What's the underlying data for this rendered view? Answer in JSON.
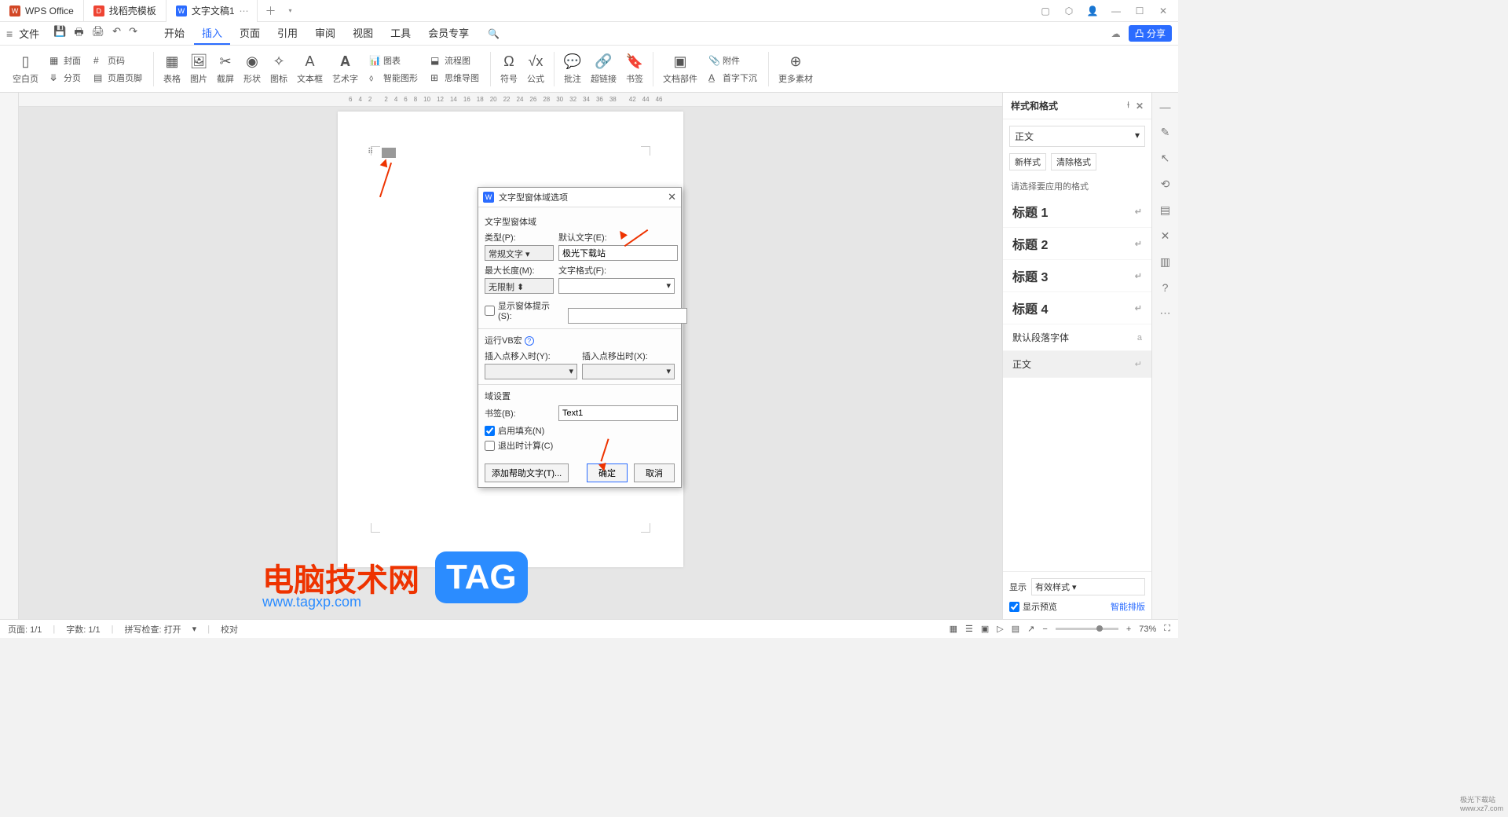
{
  "titlebar": {
    "tabs": [
      {
        "icon": "W",
        "label": "WPS Office"
      },
      {
        "icon": "D",
        "label": "找稻壳模板"
      },
      {
        "icon": "W",
        "label": "文字文稿1"
      }
    ]
  },
  "menubar": {
    "file": "文件",
    "tabs": [
      "开始",
      "插入",
      "页面",
      "引用",
      "审阅",
      "视图",
      "工具",
      "会员专享"
    ],
    "active_tab": "插入",
    "share": "分享"
  },
  "ribbon": {
    "blank_page": "空白页",
    "cover": "封面",
    "page_number": "页码",
    "page_break": "分页",
    "header_footer": "页眉页脚",
    "table": "表格",
    "picture": "图片",
    "screenshot": "截屏",
    "shape": "形状",
    "icon": "图标",
    "textbox": "文本框",
    "wordart": "艺术字",
    "chart": "图表",
    "flowchart": "流程图",
    "smartart": "智能图形",
    "mindmap": "思维导图",
    "symbol": "符号",
    "equation": "公式",
    "comment": "批注",
    "hyperlink": "超链接",
    "bookmark": "书签",
    "doc_parts": "文档部件",
    "attachment": "附件",
    "dropcap": "首字下沉",
    "more": "更多素材"
  },
  "ruler_numbers": [
    "6",
    "4",
    "2",
    "",
    "2",
    "4",
    "6",
    "8",
    "10",
    "12",
    "14",
    "16",
    "18",
    "20",
    "22",
    "24",
    "26",
    "28",
    "30",
    "32",
    "34",
    "36",
    "38",
    "",
    "42",
    "44",
    "46"
  ],
  "dialog": {
    "title": "文字型窗体域选项",
    "group1": "文字型窗体域",
    "type_label": "类型(P):",
    "type_value": "常规文字",
    "default_label": "默认文字(E):",
    "default_value": "极光下载站",
    "maxlen_label": "最大长度(M):",
    "maxlen_value": "无限制",
    "format_label": "文字格式(F):",
    "format_value": "",
    "prompt_check": "显示窗体提示(S):",
    "vb_group": "运行VB宏",
    "vb_help_icon": "?",
    "entry_label": "插入点移入时(Y):",
    "exit_label": "插入点移出时(X):",
    "settings_group": "域设置",
    "bookmark_label": "书签(B):",
    "bookmark_value": "Text1",
    "enable_fill": "启用填充(N)",
    "calc_exit": "退出时计算(C)",
    "help_btn": "添加帮助文字(T)...",
    "ok": "确定",
    "cancel": "取消"
  },
  "right_panel": {
    "title": "样式和格式",
    "current": "正文",
    "new_style": "新样式",
    "clear_format": "清除格式",
    "hint": "请选择要应用的格式",
    "items": [
      {
        "label": "标题 1"
      },
      {
        "label": "标题 2"
      },
      {
        "label": "标题 3"
      },
      {
        "label": "标题 4"
      },
      {
        "label": "默认段落字体"
      },
      {
        "label": "正文"
      }
    ],
    "show_label": "显示",
    "show_value": "有效样式",
    "preview_check": "显示预览",
    "smart_typeset": "智能排版"
  },
  "statusbar": {
    "page": "页面: 1/1",
    "words": "字数: 1/1",
    "spell": "拼写检查: 打开",
    "proof": "校对",
    "zoom": "73%"
  },
  "watermark": {
    "text": "电脑技术网",
    "url": "www.tagxp.com",
    "tag": "TAG",
    "corner": "极光下载站",
    "site": "www.xz7.com"
  }
}
